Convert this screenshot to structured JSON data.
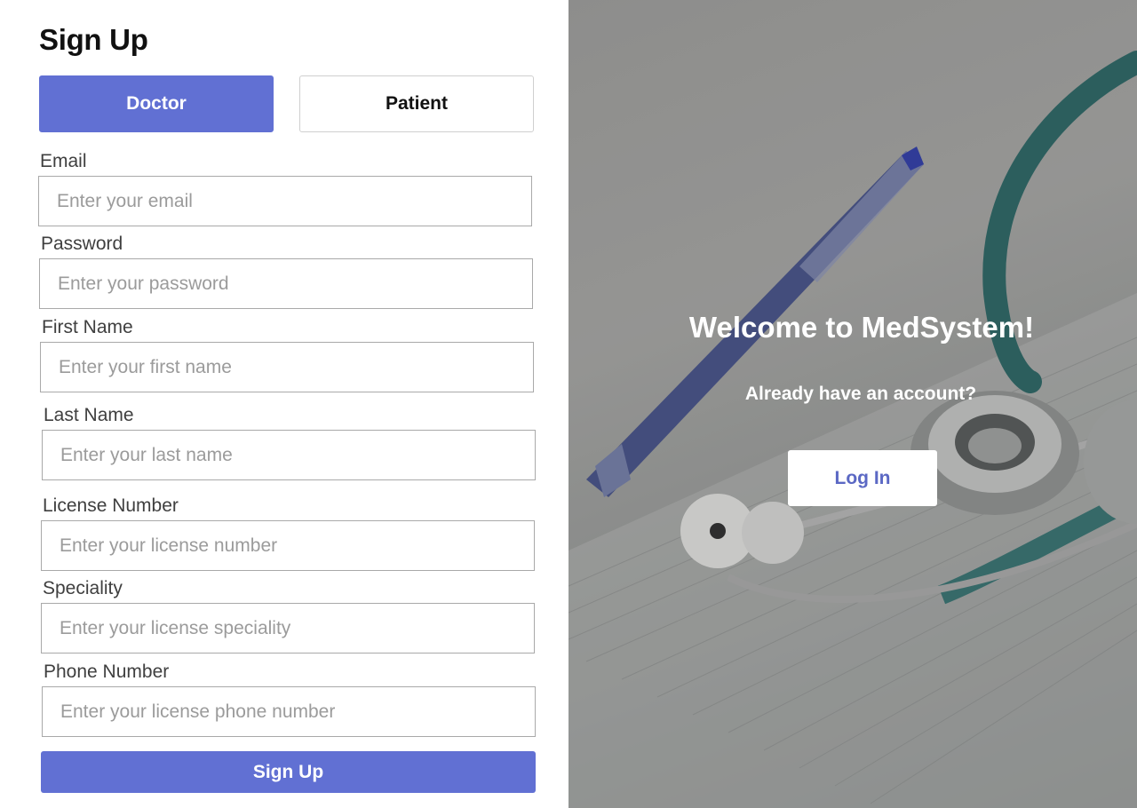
{
  "signup": {
    "title": "Sign Up",
    "roles": {
      "doctor": "Doctor",
      "patient": "Patient",
      "selected": "Doctor"
    },
    "fields": {
      "email": {
        "label": "Email",
        "placeholder": "Enter your email"
      },
      "password": {
        "label": "Password",
        "placeholder": "Enter your password"
      },
      "first_name": {
        "label": "First Name",
        "placeholder": "Enter your first name"
      },
      "last_name": {
        "label": "Last Name",
        "placeholder": "Enter your last name"
      },
      "license_number": {
        "label": "License Number",
        "placeholder": "Enter your license number"
      },
      "speciality": {
        "label": "Speciality",
        "placeholder": "Enter your license speciality"
      },
      "phone_number": {
        "label": "Phone Number",
        "placeholder": "Enter your license phone number"
      }
    },
    "submit_label": "Sign Up"
  },
  "welcome": {
    "heading": "Welcome to MedSystem!",
    "subtext": "Already have an account?",
    "login_label": "Log In",
    "background_image": "stethoscope-and-pen-on-medical-chart"
  },
  "colors": {
    "accent": "#6170d3",
    "login_text": "#5b68c4",
    "overlay": "#9c9c9a"
  }
}
